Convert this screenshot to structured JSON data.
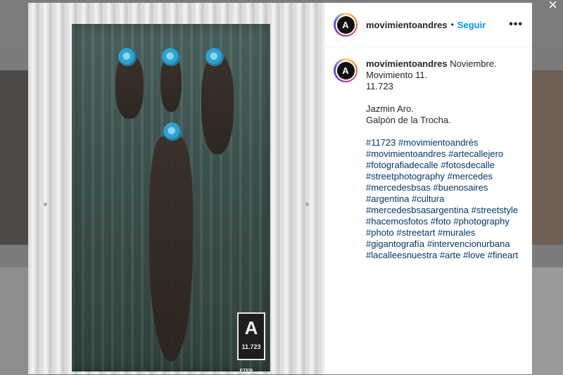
{
  "post": {
    "username": "movimientoandres",
    "follow_label": "Seguir",
    "separator": "•",
    "more_label": "•••",
    "close_label": "×",
    "avatar_letter": "A",
    "poster_mark": "A",
    "poster_number": "11.723",
    "poster_small_text": "ETER",
    "caption_lines": [
      "Noviembre.",
      "Movimiento 11.",
      "11.723",
      "",
      "Jazmin Aro.",
      "Galpón de la Trocha."
    ],
    "hashtag_lines": [
      [
        "#11723",
        "#movimientoandrès"
      ],
      [
        "#movimientoandres",
        "#artecallejero"
      ],
      [
        "#fotografiadecalle",
        "#fotosdecalle"
      ],
      [
        "#streetphotography",
        "#mercedes"
      ],
      [
        "#mercedesbsas",
        "#buenosaires"
      ],
      [
        "#argentina",
        "#cultura"
      ],
      [
        "#mercedesbsasargentina",
        "#streetstyle"
      ],
      [
        "#hacemosfotos",
        "#foto",
        "#photography"
      ],
      [
        "#photo",
        "#streetart",
        "#murales"
      ],
      [
        "#gigantografía",
        "#intervencionurbana"
      ],
      [
        "#lacalleesnuestra",
        "#arte",
        "#love",
        "#fineart"
      ]
    ]
  },
  "colors": {
    "follow": "#0095f6",
    "hashtag": "#00376b",
    "text": "#262626"
  }
}
